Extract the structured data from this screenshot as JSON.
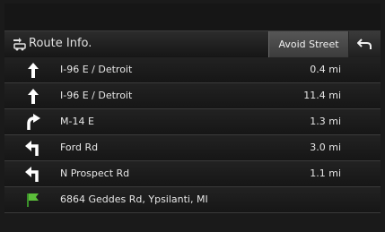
{
  "header": {
    "title": "Route Info.",
    "avoid_street_label": "Avoid Street",
    "route_icon": "route-info-icon",
    "back_icon": "back-arrow-icon"
  },
  "route_steps": [
    {
      "icon": "straight-arrow-icon",
      "name": "I-96 E / Detroit",
      "distance": "0.4 mi"
    },
    {
      "icon": "straight-arrow-icon",
      "name": "I-96 E / Detroit",
      "distance": "11.4 mi"
    },
    {
      "icon": "slight-right-arrow-icon",
      "name": "M-14 E",
      "distance": "1.3 mi"
    },
    {
      "icon": "left-turn-arrow-icon",
      "name": "Ford Rd",
      "distance": "3.0 mi"
    },
    {
      "icon": "left-turn-arrow-icon",
      "name": "N Prospect Rd",
      "distance": "1.1 mi"
    },
    {
      "icon": "destination-flag-icon",
      "name": "6864 Geddes Rd, Ypsilanti, MI",
      "distance": ""
    }
  ],
  "colors": {
    "background": "#1a1a1a",
    "text": "#e6e6e6",
    "flag": "#5cbf3a",
    "button": "#4a4a4a"
  }
}
